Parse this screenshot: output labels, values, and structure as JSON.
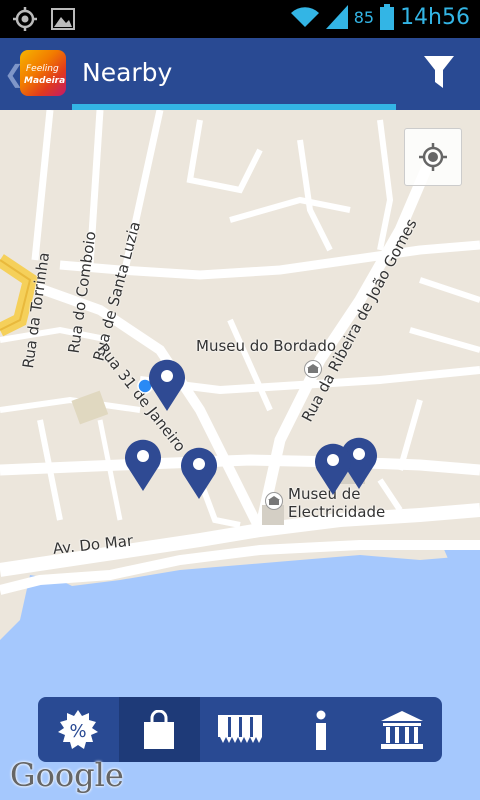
{
  "status_bar": {
    "battery": "85",
    "time": "14h56",
    "icons": [
      "gps-icon",
      "image-icon",
      "wifi-icon",
      "signal-icon",
      "battery-icon"
    ]
  },
  "action_bar": {
    "title": "Nearby",
    "logo_line1": "Feeling",
    "logo_line2": "Madeira",
    "actions": [
      "back-chevron-icon",
      "filter-icon"
    ]
  },
  "map": {
    "streets": [
      "Rua da Torrinha",
      "Rua do Comboio",
      "Rua de Santa Luzia",
      "Rua da Ribeira de João Gomes",
      "Rua 31 de Janeiro",
      "Av. Do Mar"
    ],
    "points_of_interest": [
      "Museu do Bordado",
      "Museu de Electricidade"
    ],
    "attribution": "Google",
    "colors": {
      "land": "#ece6dc",
      "road": "#ffffff",
      "water": "#a5c8fd",
      "major_road": "#f5d05a",
      "marker": "#2f4a93"
    }
  },
  "bottom_nav": {
    "tabs": [
      {
        "name": "discounts",
        "icon": "percent-icon",
        "active": false
      },
      {
        "name": "shopping",
        "icon": "shopping-bag-icon",
        "active": true
      },
      {
        "name": "events",
        "icon": "ticket-icon",
        "active": false
      },
      {
        "name": "info",
        "icon": "info-icon",
        "active": false
      },
      {
        "name": "museums",
        "icon": "museum-icon",
        "active": false
      }
    ]
  }
}
